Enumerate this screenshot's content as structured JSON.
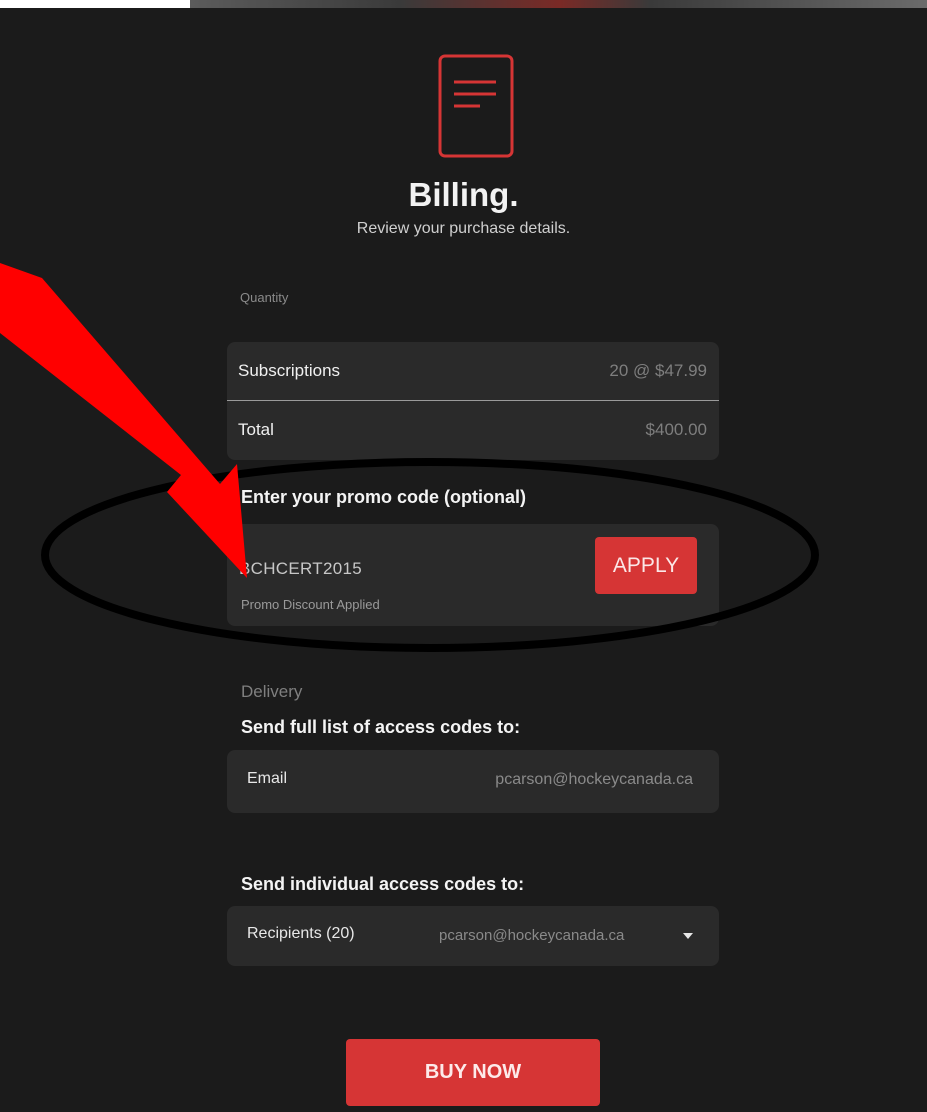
{
  "header": {
    "icon": "document-icon",
    "title": "Billing.",
    "subtitle": "Review your purchase details."
  },
  "quantity": {
    "label": "Quantity",
    "rows": [
      {
        "label": "Subscriptions",
        "value": "20 @ $47.99"
      },
      {
        "label": "Total",
        "value": "$400.00"
      }
    ]
  },
  "promo": {
    "heading": "Enter your promo code (optional)",
    "code": "BCHCERT2015",
    "status": "Promo Discount Applied",
    "apply_label": "APPLY"
  },
  "delivery": {
    "label": "Delivery",
    "full_list_heading": "Send full list of access codes to:",
    "email_label": "Email",
    "email_value": "pcarson@hockeycanada.ca",
    "individual_heading": "Send individual access codes to:",
    "recipients_label": "Recipients (20)",
    "recipients_value": "pcarson@hockeycanada.ca"
  },
  "actions": {
    "buy_label": "BUY NOW"
  },
  "colors": {
    "background": "#1b1b1b",
    "card": "#2a2a2a",
    "accent": "#d63535",
    "annotation_arrow": "#ff0000",
    "annotation_ellipse": "#000000"
  }
}
